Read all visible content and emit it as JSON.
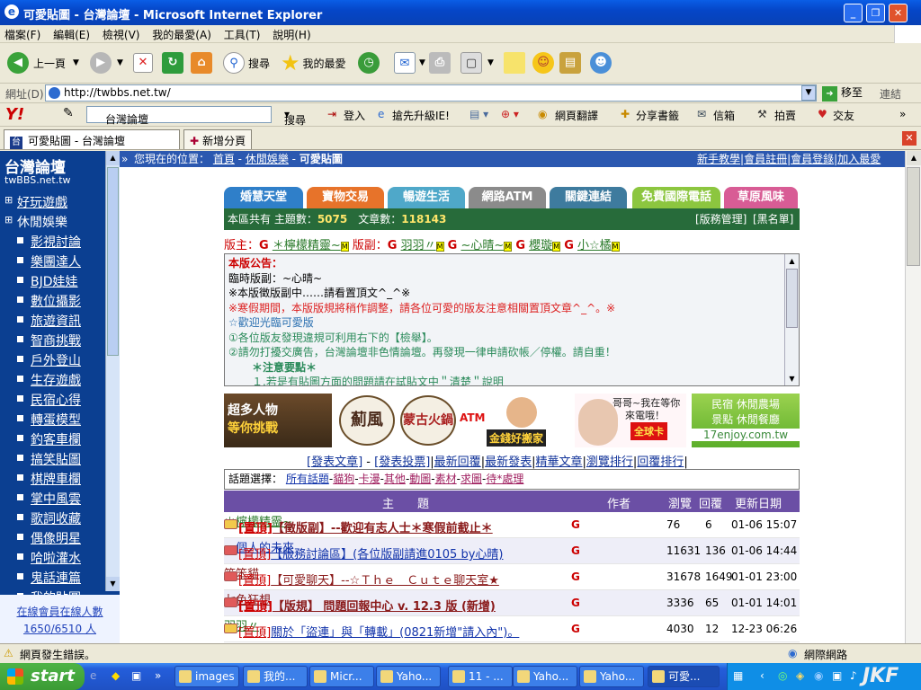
{
  "window": {
    "title": "可愛貼圖 - 台灣論壇 - Microsoft Internet Explorer"
  },
  "menu": [
    "檔案(F)",
    "編輯(E)",
    "檢視(V)",
    "我的最愛(A)",
    "工具(T)",
    "說明(H)"
  ],
  "toolbar": {
    "back": "上一頁",
    "search": "搜尋",
    "favorites": "我的最愛"
  },
  "address": {
    "label": "網址(D)",
    "url": "http://twbbs.net.tw/",
    "go": "移至",
    "links": "連結"
  },
  "yahoo_bar": {
    "search_value": "台灣論壇",
    "search_btn": "搜尋",
    "login": "登入",
    "upgrade": "搶先升級IE!",
    "translate": "網頁翻譯",
    "share": "分享書籤",
    "mail": "信箱",
    "auction": "拍賣",
    "dating": "交友"
  },
  "tabs": {
    "active": "可愛貼圖 - 台灣論壇",
    "new_tab": "新增分頁"
  },
  "sidebar": {
    "logo": "台灣論壇",
    "logo_sub": "twBBS.net.tw",
    "cat1": "好玩遊戲",
    "cat2": "休閒娛樂",
    "items": [
      "影視討論",
      "樂團達人",
      "BJD娃娃",
      "數位攝影",
      "旅遊資訊",
      "智商挑戰",
      "戶外登山",
      "生存遊戲",
      "民宿心得",
      "轉蛋模型",
      "釣客車欄",
      "搞笑貼圖",
      "棋牌車欄",
      "掌中風雲",
      "歌詞收藏",
      "偶像明星",
      "哈啦灌水",
      "鬼話連篇",
      "我的貼圖"
    ],
    "online_label": "在線會員在線人數",
    "online_count": "1650/6510 人"
  },
  "breadcrumb": {
    "prefix": "您現在的位置：",
    "home": "首頁",
    "sep1": " - ",
    "cat": "休閒娛樂",
    "sep2": " - ",
    "current": "可愛貼圖",
    "links": [
      "新手教學",
      "會員註冊",
      "會員登錄",
      "加入最愛"
    ]
  },
  "nav_tabs": [
    {
      "label": "婚慧天堂",
      "color": "#2f7fc9"
    },
    {
      "label": "寶物交易",
      "color": "#e7732a"
    },
    {
      "label": "暢遊生活",
      "color": "#4fa8c9"
    },
    {
      "label": "網路ATM",
      "color": "#8b8b8b"
    },
    {
      "label": "關鍵連結",
      "color": "#3e7b9e"
    },
    {
      "label": "免費國際電話",
      "color": "#8cc63f"
    },
    {
      "label": "草原風味",
      "color": "#d85c95"
    }
  ],
  "stats": {
    "label_topics": "本區共有 主題數：",
    "topics": "5075",
    "label_posts": "文章數：",
    "posts": "118143",
    "admin": "[版務管理]",
    "blacklist": "[黑名單]"
  },
  "moderators": {
    "label1": "版主：",
    "m1": "＊檸檬精靈~",
    "label2": "版副：",
    "m2": "羽羽〃",
    "m3": "~心晴~",
    "m4": "櫻璇",
    "m5": "小☆橘"
  },
  "notice": {
    "title": "本版公告：",
    "lines": [
      "臨時版副：~心晴~",
      "※本版徵版副中……請看置頂文^_^※",
      "※寒假期間，本版版規將稍作調整，請各位可愛的版友注意相關置頂文章^_^。※",
      "☆歡迎光臨可愛版",
      "①各位版友發現違規可利用右下的【檢舉】。",
      "②請勿打擾交廣告，台灣論壇非色情論壇。再發現一律申請砍帳／停權。請自重！",
      "＊注意要點＊",
      "１.若是有貼圖方面的問題請在試貼文中＂清楚＂說明"
    ]
  },
  "banners": {
    "b1a": "超多人物",
    "b1b": "等你挑戰",
    "b2": "薊風",
    "b3": "蒙古火鍋",
    "b4a": "ATM",
    "b4b": "金錢好搬家",
    "b5a": "哥哥~我在等你",
    "b5b": "來電哦！",
    "b5c": "全球卡",
    "b6a": "民宿 休閒農場",
    "b6b": "景點 休閒餐廳",
    "b6c": "17enjoy.com.tw"
  },
  "post_links": [
    "[發表文章]",
    "[發表投票]",
    "最新回覆",
    "最新發表",
    "精華文章",
    "瀏覽排行",
    "回覆排行"
  ],
  "topic_filter": {
    "label": "話題選擇：",
    "items": [
      "所有話題",
      "貓狗",
      "卡漫",
      "其他",
      "動圖",
      "素材",
      "求圖",
      "待*處理"
    ]
  },
  "thread_header": {
    "topic": "主　　題",
    "author": "作者",
    "views": "瀏覽",
    "replies": "回覆",
    "date": "更新日期"
  },
  "threads": [
    {
      "tag": "[置頂]",
      "title": "【徵版副】--歡迎有志人士＊寒假前截止＊",
      "author": "＊檸檬精靈~",
      "views": "76",
      "replies": "6",
      "date": "01-06 15:07"
    },
    {
      "tag": "[置頂]",
      "title": "【版務討論區】(各位版副請進0105 by心晴)",
      "author": "一個人的未來",
      "views": "11631",
      "replies": "136",
      "date": "01-06 14:44"
    },
    {
      "tag": "[置頂]",
      "title": "【可愛聊天】--☆Ｔｈｅ　Ｃｕｔｅ聊天室★",
      "author": "笨笨貓",
      "views": "31678",
      "replies": "1649",
      "date": "01-01 23:00"
    },
    {
      "tag": "[置頂]",
      "title": "【版規】 問題回報中心 v. 12.3 版 (新增)",
      "author": "七色狂想",
      "views": "3336",
      "replies": "65",
      "date": "01-01 14:01"
    },
    {
      "tag": "[置頂]",
      "title": "關於「盜連」與「轉載」(0821新增\"請入內\")。",
      "author": "羽羽〃",
      "views": "4030",
      "replies": "12",
      "date": "12-23 06:26"
    }
  ],
  "status": {
    "text": "網頁發生錯誤。",
    "zone": "網際網路"
  },
  "taskbar": {
    "start": "start",
    "tasks": [
      "images",
      "我的...",
      "Micr...",
      "Yaho...",
      "11 - ...",
      "Yaho...",
      "Yaho...",
      "可愛..."
    ],
    "watermark": "JKF"
  }
}
